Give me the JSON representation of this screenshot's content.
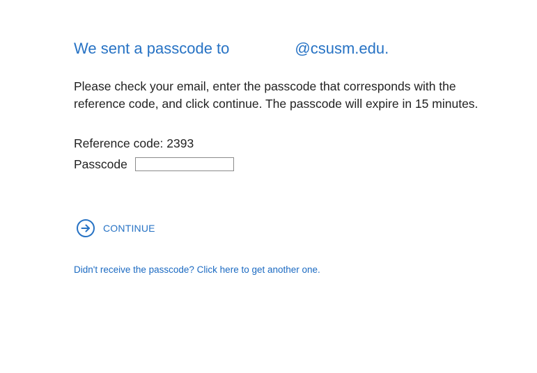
{
  "header": {
    "sent_prefix": "We sent a passcode to",
    "email_domain": "@csusm.edu."
  },
  "instructions": "Please check your email, enter the passcode that corresponds with the reference code, and click continue. The passcode will expire in 15 minutes.",
  "reference": {
    "text": "Reference code: 2393"
  },
  "passcode": {
    "label": "Passcode",
    "value": "",
    "placeholder": ""
  },
  "continue": {
    "label": "CONTINUE",
    "icon": "arrow-right-circle-icon"
  },
  "resend_link": "Didn't receive the passcode? Click here to get another one.",
  "colors": {
    "accent": "#2672c4",
    "text": "#222222",
    "input_border": "#8a8a8a"
  }
}
